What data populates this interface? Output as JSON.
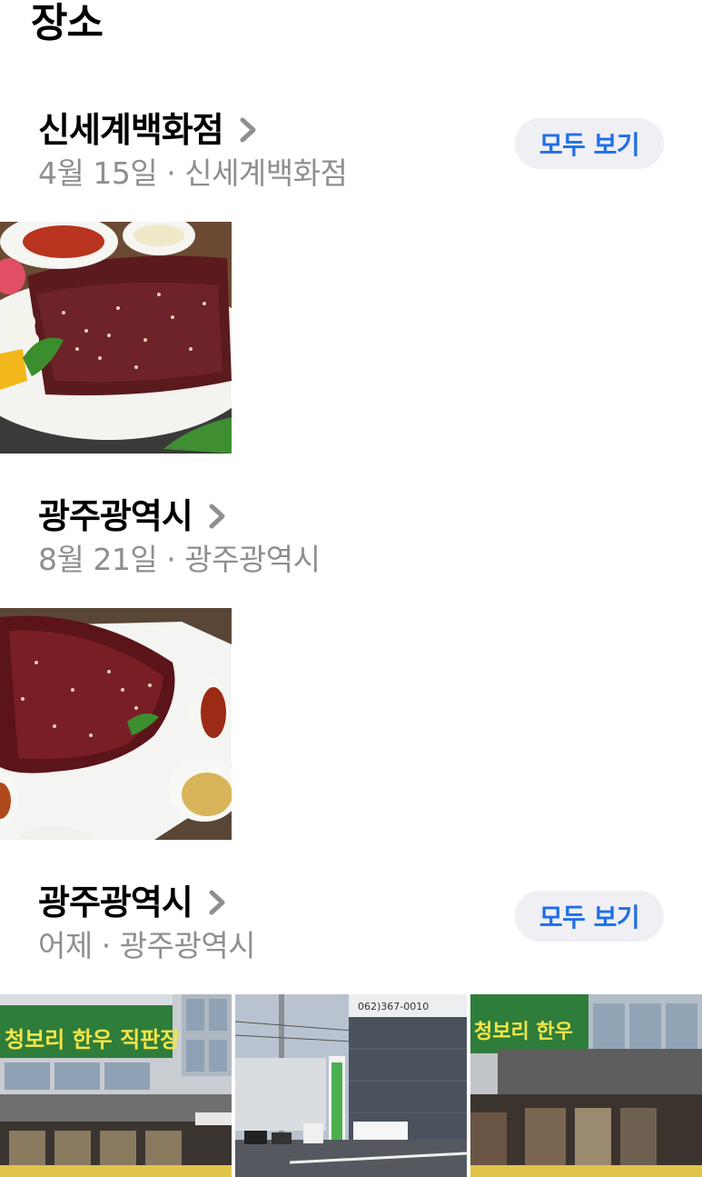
{
  "page_title": "장소",
  "sections": [
    {
      "title": "신세계백화점",
      "date": "4월 15일",
      "separator": "·",
      "place": "신세계백화점",
      "see_all_label": "모두 보기"
    },
    {
      "title": "광주광역시",
      "date": "8월 21일",
      "separator": "·",
      "place": "광주광역시"
    },
    {
      "title": "광주광역시",
      "date": "어제",
      "separator": "·",
      "place": "광주광역시",
      "see_all_label": "모두 보기",
      "photo_texts": {
        "sign1": "청보리 한우 직판장",
        "sign2_phone": "062)367-0010",
        "sign3": "청보리 한우"
      }
    }
  ],
  "colors": {
    "secondary_text": "#8e8e93",
    "accent": "#1f6fe8",
    "pill_bg": "#efeff4"
  },
  "icons": {
    "chevron": "chevron-right-icon"
  }
}
